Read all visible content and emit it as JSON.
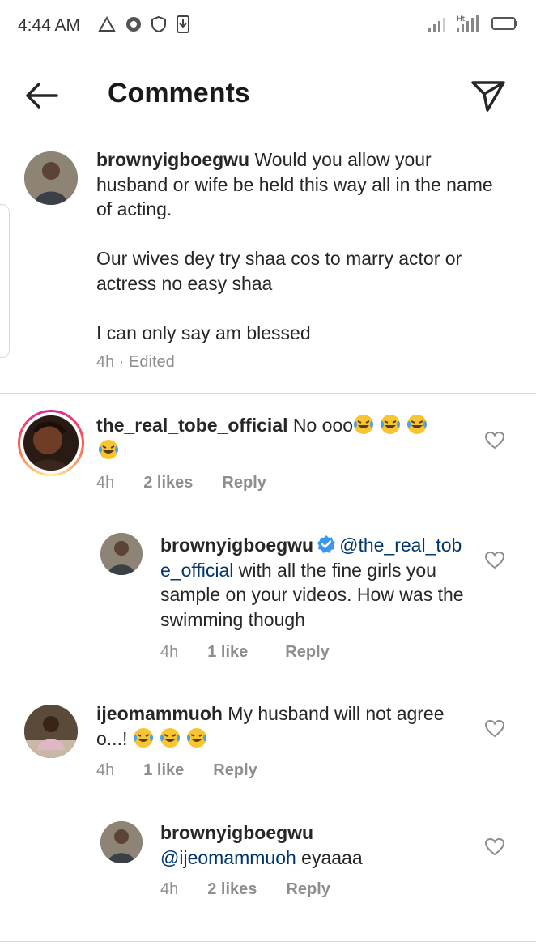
{
  "status": {
    "time": "4:44 AM"
  },
  "header": {
    "title": "Comments"
  },
  "icons": {
    "back": "arrow-left-icon",
    "send": "paper-plane-icon",
    "heart": "heart-outline-icon",
    "verified": "verified-badge-icon"
  },
  "caption": {
    "username": "brownyigboegwu",
    "text1": " Would you allow your husband or wife be held this way all in the name of acting.",
    "text2": "Our wives dey try shaa cos to marry actor or actress no easy shaa",
    "text3": "I can only say am blessed",
    "time": "4h",
    "sep": " · ",
    "edited": "Edited"
  },
  "comments": [
    {
      "username": "the_real_tobe_official",
      "text": " No ooo",
      "time": "4h",
      "likes": "2 likes",
      "reply": "Reply"
    },
    {
      "username": "brownyigboegwu",
      "mention": "@the_real_tobe_official",
      "text": " with all the fine girls you sample on your videos. How was the swimming though",
      "time": "4h",
      "likes": "1 like",
      "reply": "Reply"
    },
    {
      "username": "ijeomammuoh",
      "text": " My husband will not agree o...! ",
      "time": "4h",
      "likes": "1 like",
      "reply": "Reply"
    },
    {
      "username": "brownyigboegwu",
      "mention": "@ijeomammuoh",
      "text": " eyaaaa",
      "time": "4h",
      "likes": "2 likes",
      "reply": "Reply"
    }
  ],
  "colors": {
    "mention": "#00376b",
    "muted": "#8e8e8e",
    "text": "#262626"
  }
}
